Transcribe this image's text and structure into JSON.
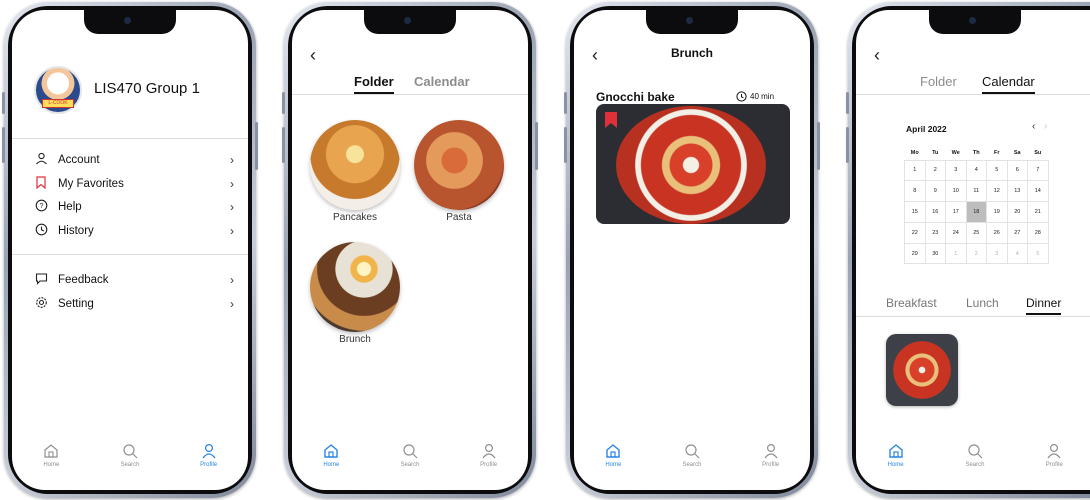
{
  "phone1": {
    "profile_name": "LIS470 Group 1",
    "avatar_tag": "L-COOK",
    "menu": [
      {
        "label": "Account",
        "icon": "user-icon"
      },
      {
        "label": "My Favorites",
        "icon": "bookmark-icon"
      },
      {
        "label": "Help",
        "icon": "help-icon"
      },
      {
        "label": "History",
        "icon": "clock-icon"
      },
      {
        "label": "Feedback",
        "icon": "chat-icon"
      },
      {
        "label": "Setting",
        "icon": "gear-icon"
      }
    ],
    "tabs": [
      "Home",
      "Search",
      "Profile"
    ],
    "active_tab": "Profile"
  },
  "phone2": {
    "segments": [
      "Folder",
      "Calendar"
    ],
    "active_segment": "Folder",
    "folders": [
      "Pancakes",
      "Pasta",
      "Brunch"
    ],
    "tabs": [
      "Home",
      "Search",
      "Profile"
    ],
    "active_tab": "Home"
  },
  "phone3": {
    "title": "Brunch",
    "recipe_name": "Gnocchi bake",
    "time": "40 min",
    "tabs": [
      "Home",
      "Search",
      "Profile"
    ],
    "active_tab": "Home"
  },
  "phone4": {
    "segments": [
      "Folder",
      "Calendar"
    ],
    "active_segment": "Calendar",
    "month": "April 2022",
    "weekdays": [
      "Mo",
      "Tu",
      "We",
      "Th",
      "Fr",
      "Sa",
      "Su"
    ],
    "weeks": [
      [
        "1",
        "2",
        "3",
        "4",
        "5",
        "6",
        "7"
      ],
      [
        "8",
        "9",
        "10",
        "11",
        "12",
        "13",
        "14"
      ],
      [
        "15",
        "16",
        "17",
        "18",
        "19",
        "20",
        "21"
      ],
      [
        "22",
        "23",
        "24",
        "25",
        "26",
        "27",
        "28"
      ],
      [
        "29",
        "30",
        "1",
        "2",
        "3",
        "4",
        "5"
      ]
    ],
    "selected_day": "18",
    "meals": [
      "Breakfast",
      "Lunch",
      "Dinner"
    ],
    "active_meal": "Dinner",
    "tabs": [
      "Home",
      "Search",
      "Profile"
    ],
    "active_tab": "Home"
  },
  "colors": {
    "accent": "#2b87e8",
    "favorite": "#e0313b",
    "selected_day": "#bdbdbd"
  }
}
